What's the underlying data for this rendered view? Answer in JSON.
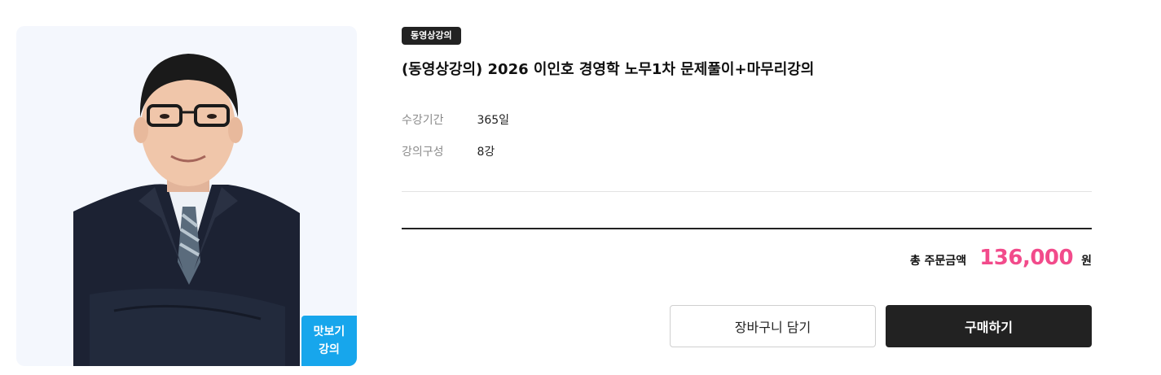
{
  "product": {
    "badge": "동영상강의",
    "title": "(동영상강의) 2026 이인호 경영학 노무1차 문제풀이+마무리강의",
    "info": [
      {
        "label": "수강기간",
        "value": "365일"
      },
      {
        "label": "강의구성",
        "value": "8강"
      }
    ]
  },
  "preview": {
    "line1": "맛보기",
    "line2": "강의"
  },
  "price": {
    "label": "총 주문금액",
    "amount": "136,000",
    "unit": "원",
    "accent_color": "#f24b8b"
  },
  "actions": {
    "cart_label": "장바구니 담기",
    "buy_label": "구매하기"
  },
  "colors": {
    "badge_bg": "#222222",
    "preview_bg": "#17a6ec",
    "photo_bg": "#f4f7fd"
  }
}
